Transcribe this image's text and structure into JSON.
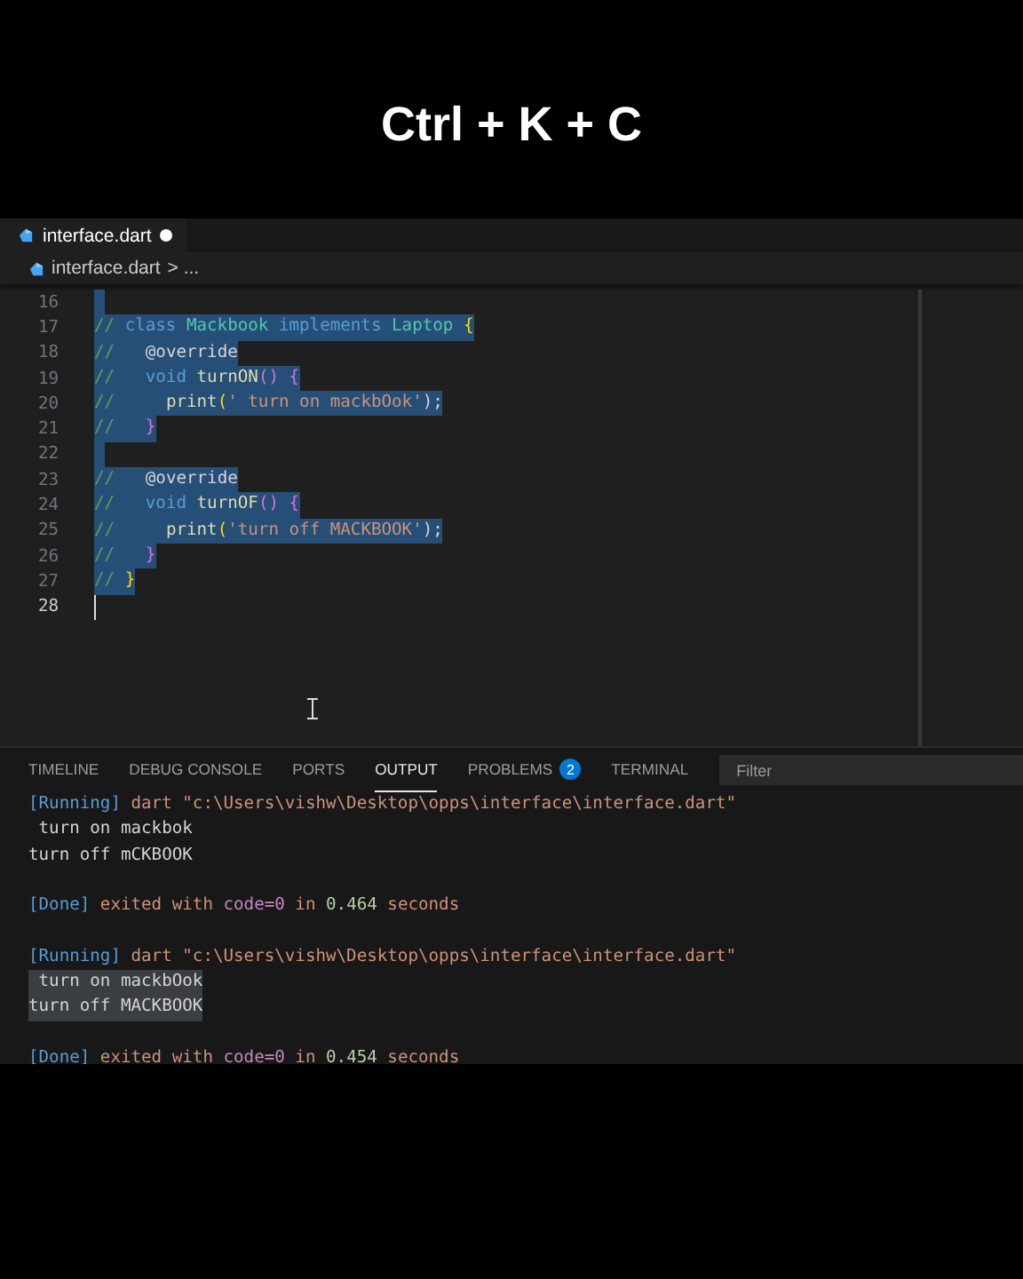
{
  "caption": "Ctrl + K + C",
  "editor": {
    "tabs": [
      {
        "label": "interface.dart",
        "selected": true,
        "modified": true
      }
    ],
    "breadcrumb": {
      "file": "interface.dart",
      "rest": "> ..."
    },
    "lines": [
      {
        "number": "16",
        "selected": true,
        "caret": false
      },
      {
        "number": "17",
        "selected": true,
        "caret": false,
        "tokens": [
          {
            "text": "// ",
            "kind": "comment"
          },
          {
            "text": "class ",
            "kind": "keyword"
          },
          {
            "text": "Mackbook ",
            "kind": "type"
          },
          {
            "text": "implements ",
            "kind": "keyword"
          },
          {
            "text": "Laptop ",
            "kind": "type"
          },
          {
            "text": "{",
            "kind": "brace"
          }
        ]
      },
      {
        "number": "18",
        "selected": true,
        "caret": false,
        "tokens": [
          {
            "text": "//   ",
            "kind": "comment"
          },
          {
            "text": "@override",
            "kind": "plain"
          }
        ]
      },
      {
        "number": "19",
        "selected": true,
        "caret": false,
        "tokens": [
          {
            "text": "//   ",
            "kind": "comment"
          },
          {
            "text": "void ",
            "kind": "keyword"
          },
          {
            "text": "turnON",
            "kind": "function"
          },
          {
            "text": "() ",
            "kind": "paren"
          },
          {
            "text": "{",
            "kind": "paren"
          }
        ]
      },
      {
        "number": "20",
        "selected": true,
        "caret": false,
        "tokens": [
          {
            "text": "//     ",
            "kind": "comment"
          },
          {
            "text": "print",
            "kind": "function"
          },
          {
            "text": "(",
            "kind": "brace"
          },
          {
            "text": "' turn on mackbOok'",
            "kind": "string"
          },
          {
            "text": ");",
            "kind": "plain"
          }
        ]
      },
      {
        "number": "21",
        "selected": true,
        "caret": false,
        "tokens": [
          {
            "text": "//   ",
            "kind": "comment"
          },
          {
            "text": "}",
            "kind": "paren"
          }
        ]
      },
      {
        "number": "22",
        "selected": true,
        "caret": false
      },
      {
        "number": "23",
        "selected": true,
        "caret": false,
        "tokens": [
          {
            "text": "//   ",
            "kind": "comment"
          },
          {
            "text": "@override",
            "kind": "plain"
          }
        ]
      },
      {
        "number": "24",
        "selected": true,
        "caret": false,
        "tokens": [
          {
            "text": "//   ",
            "kind": "comment"
          },
          {
            "text": "void ",
            "kind": "keyword"
          },
          {
            "text": "turnOF",
            "kind": "function"
          },
          {
            "text": "() ",
            "kind": "paren"
          },
          {
            "text": "{",
            "kind": "paren"
          }
        ]
      },
      {
        "number": "25",
        "selected": true,
        "caret": false,
        "tokens": [
          {
            "text": "//     ",
            "kind": "comment"
          },
          {
            "text": "print",
            "kind": "function"
          },
          {
            "text": "(",
            "kind": "brace"
          },
          {
            "text": "'turn off MACKBOOK'",
            "kind": "string"
          },
          {
            "text": ");",
            "kind": "plain"
          }
        ]
      },
      {
        "number": "26",
        "selected": true,
        "caret": false,
        "tokens": [
          {
            "text": "//   ",
            "kind": "comment"
          },
          {
            "text": "}",
            "kind": "paren"
          }
        ]
      },
      {
        "number": "27",
        "selected": true,
        "caret": false,
        "tokens": [
          {
            "text": "// ",
            "kind": "comment"
          },
          {
            "text": "}",
            "kind": "brace"
          }
        ]
      },
      {
        "number": "28",
        "selected": false,
        "caret": true
      }
    ]
  },
  "panel": {
    "tabs": [
      {
        "label": "TIMELINE",
        "selected": false
      },
      {
        "label": "DEBUG CONSOLE",
        "selected": false
      },
      {
        "label": "PORTS",
        "selected": false
      },
      {
        "label": "OUTPUT",
        "selected": true
      },
      {
        "label": "PROBLEMS",
        "selected": false,
        "badge": "2"
      },
      {
        "label": "TERMINAL",
        "selected": false
      }
    ],
    "filter": {
      "placeholder": "Filter"
    },
    "output": [
      {
        "selected": false,
        "tokens": [
          {
            "text": "[Running]",
            "kind": "tag"
          },
          {
            "text": " dart \"c:\\Users\\vishw\\Desktop\\opps\\interface\\interface.dart\"",
            "kind": "info"
          }
        ]
      },
      {
        "selected": false,
        "tokens": [
          {
            "text": " turn on mackbok",
            "kind": "plain"
          }
        ]
      },
      {
        "selected": false,
        "tokens": [
          {
            "text": "turn off mCKBOOK",
            "kind": "plain"
          }
        ]
      },
      {
        "selected": false,
        "blank_before": true,
        "tokens": [
          {
            "text": "[Done]",
            "kind": "tag"
          },
          {
            "text": " exited with ",
            "kind": "info"
          },
          {
            "text": "code=0",
            "kind": "code"
          },
          {
            "text": " in ",
            "kind": "info"
          },
          {
            "text": "0.464",
            "kind": "number"
          },
          {
            "text": " seconds",
            "kind": "info"
          }
        ]
      },
      {
        "selected": false,
        "blank_before": true,
        "tokens": [
          {
            "text": "[Running]",
            "kind": "tag"
          },
          {
            "text": " dart \"c:\\Users\\vishw\\Desktop\\opps\\interface\\interface.dart\"",
            "kind": "info"
          }
        ]
      },
      {
        "selected": true,
        "tokens": [
          {
            "text": " turn on mackbOok",
            "kind": "plain"
          }
        ]
      },
      {
        "selected": true,
        "tokens": [
          {
            "text": "turn off MACKBOOK",
            "kind": "plain"
          }
        ]
      },
      {
        "selected": false,
        "blank_before": true,
        "tokens": [
          {
            "text": "[Done]",
            "kind": "tag"
          },
          {
            "text": " exited with ",
            "kind": "info"
          },
          {
            "text": "code=0",
            "kind": "code"
          },
          {
            "text": " in ",
            "kind": "info"
          },
          {
            "text": "0.454",
            "kind": "number"
          },
          {
            "text": " seconds",
            "kind": "info"
          }
        ]
      }
    ]
  }
}
